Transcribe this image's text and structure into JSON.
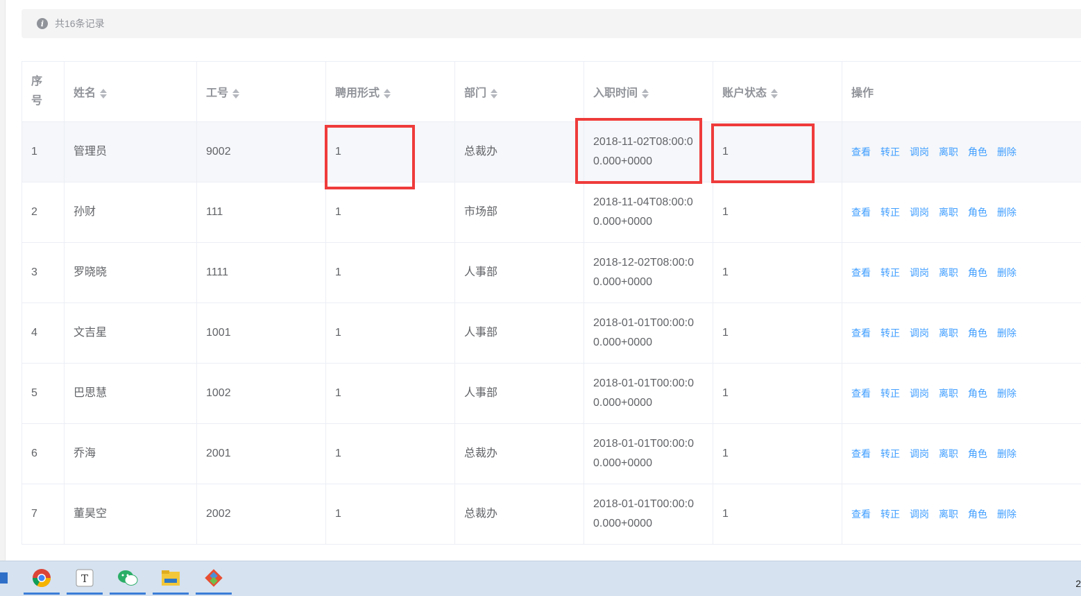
{
  "summary": "共16条记录",
  "columns": [
    "序号",
    "姓名",
    "工号",
    "聘用形式",
    "部门",
    "入职时间",
    "账户状态",
    "操作"
  ],
  "index_header_lines": [
    "序",
    "号"
  ],
  "actions": [
    "查看",
    "转正",
    "调岗",
    "离职",
    "角色",
    "删除"
  ],
  "rows": [
    {
      "idx": "1",
      "name": "管理员",
      "emp_no": "9002",
      "hire_form": "1",
      "dept": "总裁办",
      "date1": "2018-11-02T08:00:0",
      "date2": "0.000+0000",
      "status": "1"
    },
    {
      "idx": "2",
      "name": "孙财",
      "emp_no": "111",
      "hire_form": "1",
      "dept": "市场部",
      "date1": "2018-11-04T08:00:0",
      "date2": "0.000+0000",
      "status": "1"
    },
    {
      "idx": "3",
      "name": "罗晓晓",
      "emp_no": "1111",
      "hire_form": "1",
      "dept": "人事部",
      "date1": "2018-12-02T08:00:0",
      "date2": "0.000+0000",
      "status": "1"
    },
    {
      "idx": "4",
      "name": "文吉星",
      "emp_no": "1001",
      "hire_form": "1",
      "dept": "人事部",
      "date1": "2018-01-01T00:00:0",
      "date2": "0.000+0000",
      "status": "1"
    },
    {
      "idx": "5",
      "name": "巴思慧",
      "emp_no": "1002",
      "hire_form": "1",
      "dept": "人事部",
      "date1": "2018-01-01T00:00:0",
      "date2": "0.000+0000",
      "status": "1"
    },
    {
      "idx": "6",
      "name": "乔海",
      "emp_no": "2001",
      "hire_form": "1",
      "dept": "总裁办",
      "date1": "2018-01-01T00:00:0",
      "date2": "0.000+0000",
      "status": "1"
    },
    {
      "idx": "7",
      "name": "董昊空",
      "emp_no": "2002",
      "hire_form": "1",
      "dept": "总裁办",
      "date1": "2018-01-01T00:00:0",
      "date2": "0.000+0000",
      "status": "1"
    }
  ],
  "taskbar": {
    "apps": [
      "start-icon",
      "chrome-icon",
      "typora-icon",
      "wechat-icon",
      "file-explorer-icon",
      "git-icon"
    ],
    "corner_text": "2"
  },
  "colors": {
    "link": "#409eff",
    "highlight": "#ef3b3b",
    "header_text": "#909399"
  }
}
